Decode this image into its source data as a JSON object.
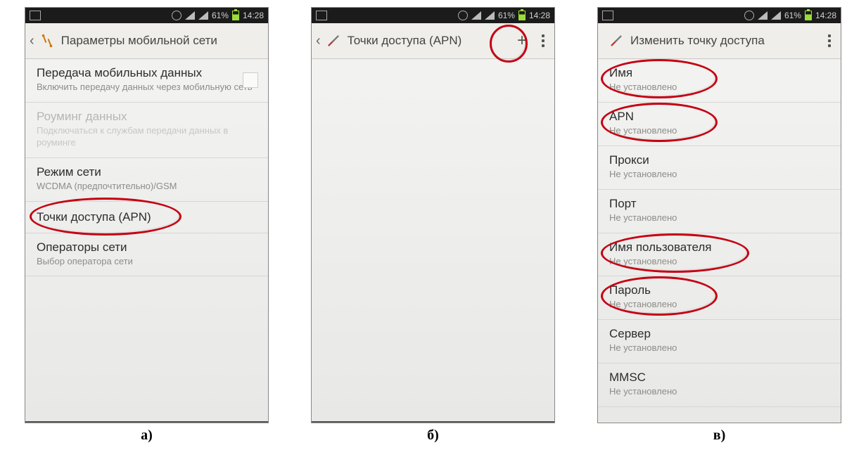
{
  "status": {
    "battery_text": "61%",
    "time": "14:28"
  },
  "screenA": {
    "caption": "а)",
    "title": "Параметры мобильной сети",
    "items": [
      {
        "title": "Передача мобильных данных",
        "subtitle": "Включить передачу данных через мобильную сеть",
        "checkbox": true
      },
      {
        "title": "Роуминг данных",
        "subtitle": "Подключаться к службам передачи данных в роуминге",
        "disabled": true
      },
      {
        "title": "Режим сети",
        "subtitle": "WCDMA (предпочтительно)/GSM"
      },
      {
        "title": "Точки доступа (APN)",
        "highlight": true
      },
      {
        "title": "Операторы сети",
        "subtitle": "Выбор оператора сети"
      }
    ]
  },
  "screenB": {
    "caption": "б)",
    "title": "Точки доступа (APN)",
    "add_label": "+",
    "highlight_add": true
  },
  "screenC": {
    "caption": "в)",
    "title": "Изменить точку доступа",
    "not_set": "Не установлено",
    "items": [
      {
        "title": "Имя",
        "highlight": true
      },
      {
        "title": "APN",
        "highlight": true
      },
      {
        "title": "Прокси"
      },
      {
        "title": "Порт"
      },
      {
        "title": "Имя пользователя",
        "highlight": true
      },
      {
        "title": "Пароль",
        "highlight": true
      },
      {
        "title": "Сервер"
      },
      {
        "title": "MMSC"
      }
    ]
  }
}
